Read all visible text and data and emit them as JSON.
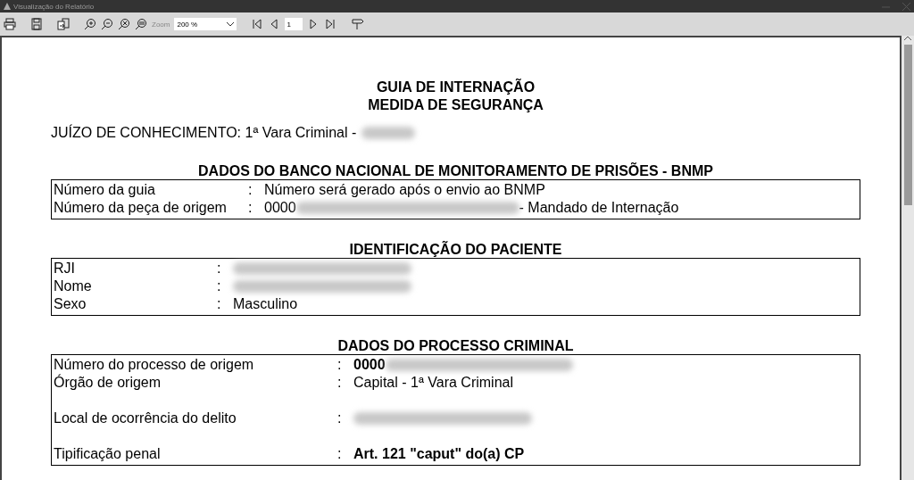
{
  "window": {
    "title": "Visualização do Relatório"
  },
  "toolbar": {
    "zoom_label": "Zoom",
    "zoom_value": "200 %",
    "page": "1"
  },
  "document": {
    "title_lines": [
      "GUIA DE INTERNAÇÃO",
      "MEDIDA DE SEGURANÇA"
    ],
    "court": {
      "text": "JUÍZO DE CONHECIMENTO: 1ª Vara Criminal -",
      "redacted": true
    },
    "sections": [
      {
        "heading": "DADOS DO BANCO NACIONAL DE MONITORAMENTO DE PRISÕES - BNMP",
        "rows": [
          {
            "kind": "line",
            "label": "Número da guia",
            "colon": ":",
            "value": "Número será gerado após o envio ao BNMP",
            "bold": false,
            "redacted": false
          },
          {
            "kind": "line",
            "label": "Número da peça de origem",
            "colon": ":",
            "value": "0000",
            "bold": false,
            "redacted": true,
            "value_after": "- Mandado de Internação"
          }
        ]
      },
      {
        "heading": "IDENTIFICAÇÃO DO PACIENTE",
        "rows": [
          {
            "kind": "line",
            "label": "RJI",
            "colon": ":",
            "redacted": true
          },
          {
            "kind": "line",
            "label": "Nome",
            "colon": ":",
            "redacted": true
          },
          {
            "kind": "line",
            "label": "Sexo",
            "colon": ":",
            "value": "Masculino",
            "bold": false,
            "redacted": false
          }
        ]
      },
      {
        "heading": "DADOS DO PROCESSO CRIMINAL",
        "rows": [
          {
            "kind": "line",
            "label": "Número do processo de origem",
            "colon": ":",
            "value": "0000",
            "bold": true,
            "redacted": true
          },
          {
            "kind": "line",
            "label": "Órgão de origem",
            "colon": ":",
            "value": "Capital - 1ª Vara Criminal",
            "bold": false,
            "redacted": false
          },
          {
            "kind": "spaced",
            "label": "Local de ocorrência do delito",
            "colon": ":",
            "redacted": true
          },
          {
            "kind": "spaced",
            "label": "Tipificação penal",
            "colon": ":",
            "value": "Art. 121 \"caput\" do(a) CP",
            "bold": true,
            "redacted": false
          }
        ]
      }
    ]
  }
}
